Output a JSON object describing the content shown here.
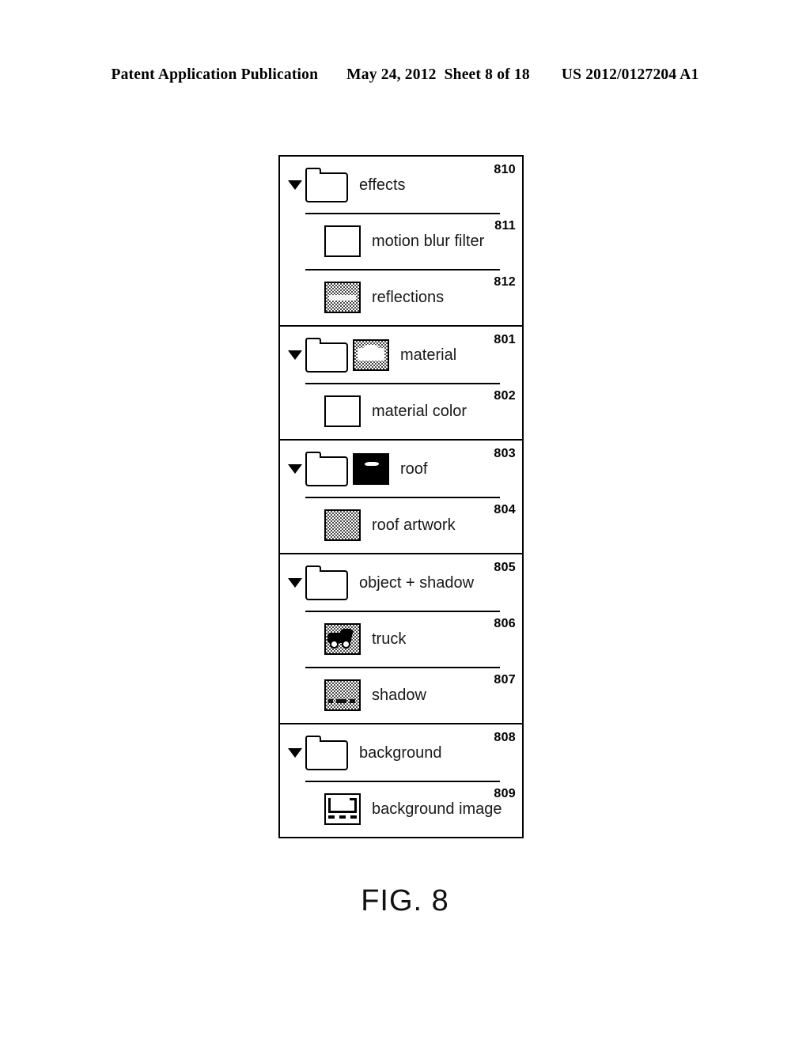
{
  "header": {
    "publication": "Patent Application Publication",
    "date": "May 24, 2012",
    "sheet": "Sheet 8 of 18",
    "patent_number": "US 2012/0127204 A1"
  },
  "figure": {
    "caption": "FIG. 8"
  },
  "panel": {
    "groups": [
      {
        "rows": [
          {
            "label": "effects",
            "ref": "810",
            "disclosure": "triangle-down-icon",
            "folder": true,
            "thumbnail": "none",
            "separator": false
          },
          {
            "label": "motion blur filter",
            "ref": "811",
            "disclosure": "none",
            "folder": false,
            "thumbnail": "empty",
            "separator": true
          },
          {
            "label": "reflections",
            "ref": "812",
            "disclosure": "none",
            "folder": false,
            "thumbnail": "dither-band",
            "separator": true
          }
        ]
      },
      {
        "rows": [
          {
            "label": "material",
            "ref": "801",
            "disclosure": "triangle-down-icon",
            "folder": true,
            "thumbnail": "dither-material",
            "separator": false
          },
          {
            "label": "material color",
            "ref": "802",
            "disclosure": "none",
            "folder": false,
            "thumbnail": "empty",
            "separator": true
          }
        ]
      },
      {
        "rows": [
          {
            "label": "roof",
            "ref": "803",
            "disclosure": "triangle-down-icon",
            "folder": true,
            "thumbnail": "black-roof",
            "separator": false
          },
          {
            "label": "roof artwork",
            "ref": "804",
            "disclosure": "none",
            "folder": false,
            "thumbnail": "dither-plain",
            "separator": true
          }
        ]
      },
      {
        "rows": [
          {
            "label": "object + shadow",
            "ref": "805",
            "disclosure": "triangle-down-icon",
            "folder": true,
            "thumbnail": "none",
            "separator": false
          },
          {
            "label": "truck",
            "ref": "806",
            "disclosure": "none",
            "folder": false,
            "thumbnail": "dither-truck",
            "separator": true
          },
          {
            "label": "shadow",
            "ref": "807",
            "disclosure": "none",
            "folder": false,
            "thumbnail": "dither-shadow",
            "separator": true
          }
        ]
      },
      {
        "rows": [
          {
            "label": "background",
            "ref": "808",
            "disclosure": "triangle-down-icon",
            "folder": true,
            "thumbnail": "none",
            "separator": false
          },
          {
            "label": "background image",
            "ref": "809",
            "disclosure": "none",
            "folder": false,
            "thumbnail": "background-outline",
            "separator": true
          }
        ]
      }
    ]
  },
  "colors": {
    "ink": "#000000",
    "paper": "#ffffff"
  }
}
